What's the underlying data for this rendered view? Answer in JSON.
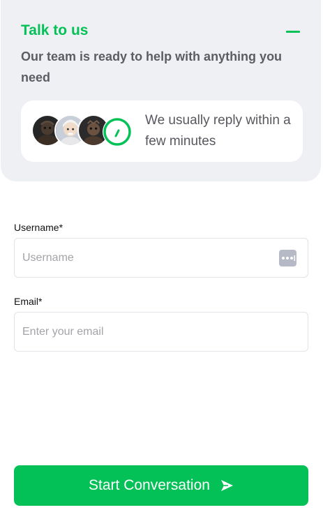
{
  "header": {
    "title": "Talk to us",
    "subtitle": "Our team is ready to help with anything you need",
    "minimize_icon": "minus-icon"
  },
  "reply_card": {
    "text": "We usually reply within a few minutes",
    "avatars": [
      "agent-avatar-1",
      "agent-avatar-2",
      "agent-avatar-3"
    ]
  },
  "form": {
    "username": {
      "label": "Username*",
      "placeholder": "Username",
      "value": ""
    },
    "email": {
      "label": "Email*",
      "placeholder": "Enter your email",
      "value": ""
    }
  },
  "submit": {
    "label": "Start Conversation",
    "icon": "send-icon"
  },
  "colors": {
    "accent": "#04c157",
    "header_bg": "#eff0f3",
    "muted_text": "#5c5c63",
    "input_border": "#e2e3e8"
  }
}
